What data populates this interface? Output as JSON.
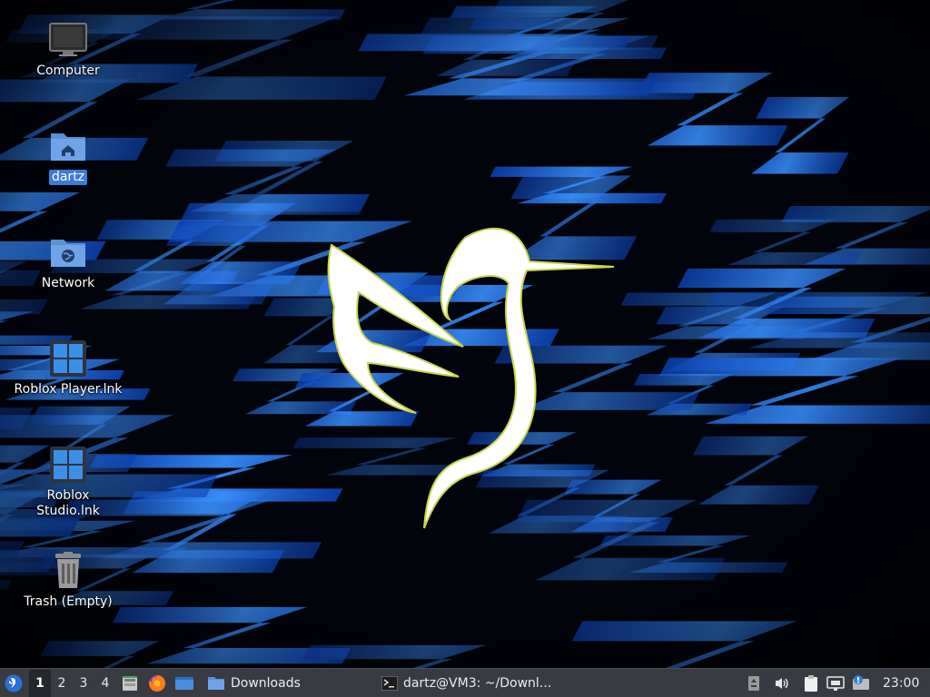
{
  "desktop": {
    "icons": [
      {
        "label": "Computer",
        "icon": "computer-icon"
      },
      {
        "label": "dartz",
        "icon": "home-folder-icon",
        "selected": true
      },
      {
        "label": "Network",
        "icon": "network-folder-icon"
      },
      {
        "label": "Roblox Player.lnk",
        "icon": "windows-app-icon"
      },
      {
        "label": "Roblox\nStudio.lnk",
        "icon": "windows-app-icon"
      },
      {
        "label": "Trash (Empty)",
        "icon": "trash-icon"
      }
    ],
    "wallpaper": {
      "logo": "duck-logo",
      "accent_color": "#2f7fff"
    }
  },
  "panel": {
    "menu_icon": "start-menu-icon",
    "workspaces": [
      "1",
      "2",
      "3",
      "4"
    ],
    "active_workspace": "1",
    "launchers": [
      "file-manager-icon",
      "firefox-icon",
      "show-desktop-icon"
    ],
    "tasks": [
      {
        "label": "Downloads",
        "icon": "folder-icon"
      },
      {
        "label": "dartz@VM3: ~/Downl...",
        "icon": "terminal-icon"
      }
    ],
    "tray": [
      "storage-icon",
      "volume-icon",
      "clipboard-icon",
      "network-wired-icon",
      "update-notifier-icon"
    ],
    "clock": "23:00"
  }
}
